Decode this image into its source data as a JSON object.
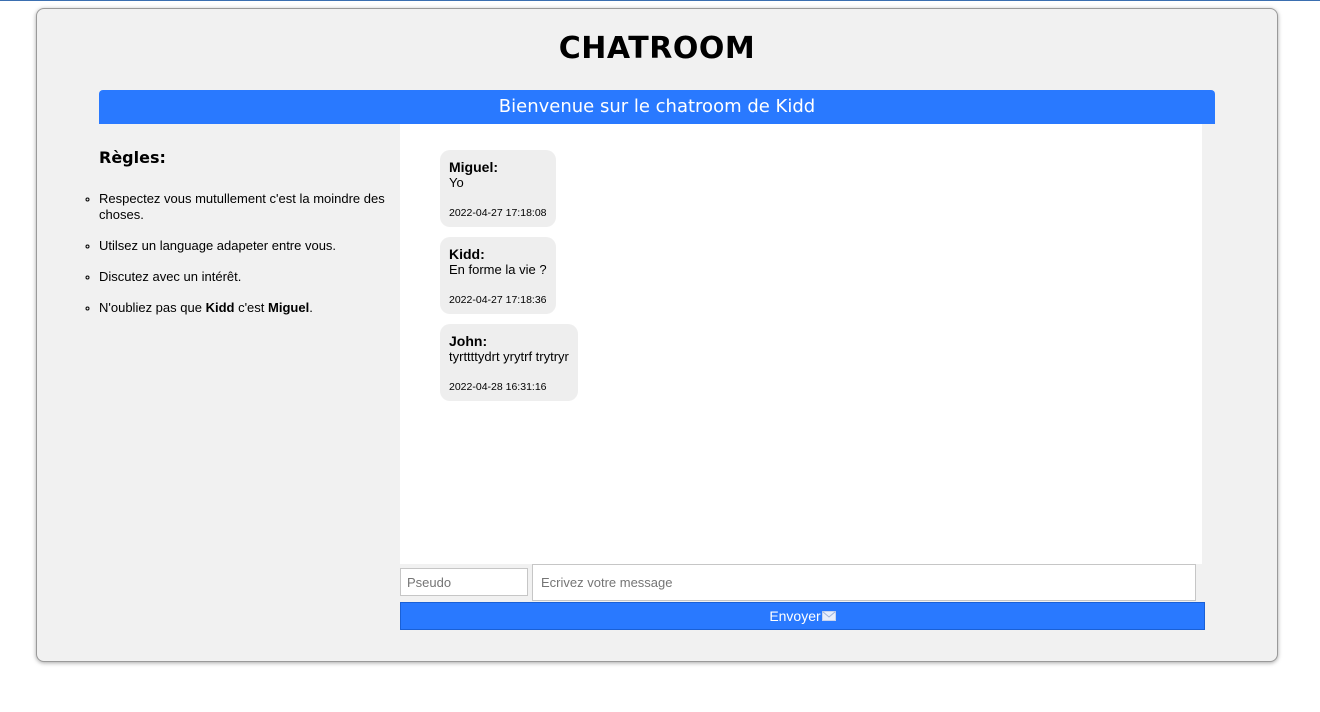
{
  "header": {
    "title": "CHATROOM"
  },
  "welcome": {
    "text": "Bienvenue sur le chatroom de Kidd"
  },
  "rules": {
    "title": "Règles:",
    "items": [
      "Respectez vous mutullement c'est la moindre des choses.",
      "Utilsez un language adapeter entre vous.",
      "Discutez avec un intérêt.",
      {
        "prefix": "N'oubliez pas que ",
        "bold1": "Kidd",
        "middle": " c'est ",
        "bold2": "Miguel",
        "suffix": "."
      }
    ]
  },
  "messages": [
    {
      "author": "Miguel:",
      "text": "Yo",
      "time": "2022-04-27 17:18:08"
    },
    {
      "author": "Kidd:",
      "text": "En forme la vie ?",
      "time": "2022-04-27 17:18:36"
    },
    {
      "author": "John:",
      "text": "tyrttttydrt yrytrf trytryr",
      "time": "2022-04-28 16:31:16"
    }
  ],
  "form": {
    "pseudo_placeholder": "Pseudo",
    "message_placeholder": "Ecrivez votre message",
    "send_label": "Envoyer",
    "send_icon": "envelope-icon"
  },
  "colors": {
    "accent": "#2979ff",
    "panel": "#f1f1f1",
    "bubble": "#eeeeee"
  }
}
